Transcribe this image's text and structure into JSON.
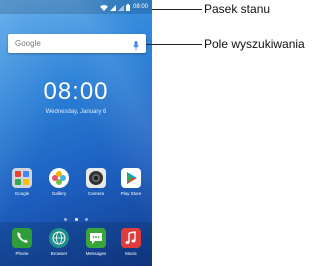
{
  "status_bar": {
    "time": "08:00",
    "icons": [
      "wifi-icon",
      "signal-icon",
      "sim-icon",
      "battery-icon"
    ]
  },
  "search": {
    "brand": "Google",
    "icon": "mic-icon"
  },
  "clock": {
    "time": "08:00",
    "date": "Wednesday, January 6"
  },
  "apps": [
    {
      "label": "Google",
      "icon": "google-folder-icon"
    },
    {
      "label": "Gallery",
      "icon": "gallery-icon"
    },
    {
      "label": "Camera",
      "icon": "camera-icon"
    },
    {
      "label": "Play Store",
      "icon": "play-store-icon"
    }
  ],
  "dock": [
    {
      "label": "Phone",
      "icon": "phone-icon",
      "color": "#2e9e3a"
    },
    {
      "label": "Browser",
      "icon": "browser-icon",
      "color": "#1f8f8a"
    },
    {
      "label": "Messages",
      "icon": "messages-icon",
      "color": "#3aa53a"
    },
    {
      "label": "Music",
      "icon": "music-icon",
      "color": "#e23b3b"
    }
  ],
  "page_indicator": {
    "count": 3,
    "active": 1
  },
  "callouts": {
    "status_bar": "Pasek stanu",
    "search_field": "Pole wyszukiwania"
  }
}
